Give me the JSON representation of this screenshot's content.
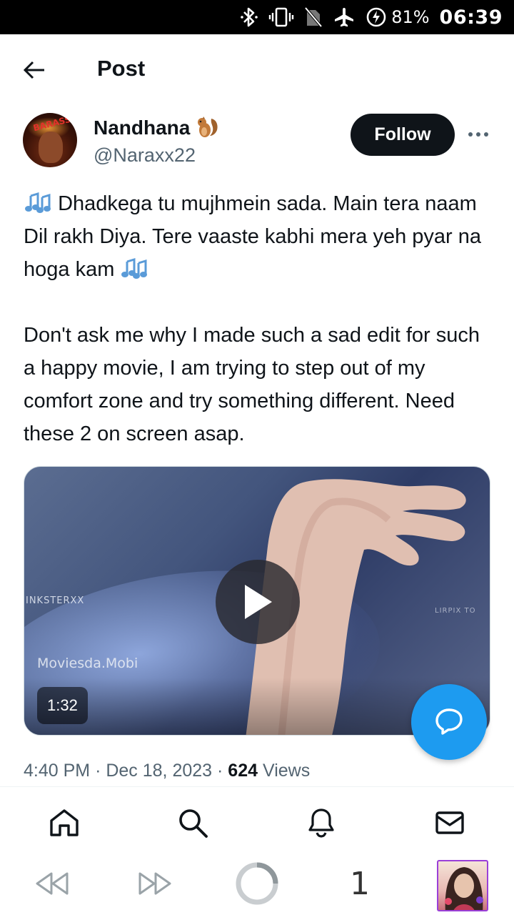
{
  "status_bar": {
    "battery_percent": "81%",
    "time": "06:39"
  },
  "header": {
    "title": "Post"
  },
  "author": {
    "name": "Nandhana",
    "handle": "@Naraxx22",
    "avatar_text": "BARASS"
  },
  "follow_label": "Follow",
  "tweet": {
    "paragraph1": "Dhadkega tu mujhmein sada. Main tera naam Dil rakh Diya. Tere vaaste kabhi mera yeh pyar na hoga  kam",
    "paragraph2": "Don't ask me why I made such a sad edit for such a happy movie, I am trying to step out of my comfort zone and try something different. Need these 2 on screen asap."
  },
  "media": {
    "duration": "1:32",
    "watermark_left": "INKSTERXX",
    "watermark_site": "Moviesda.Mobi",
    "watermark_right": "LIRPIX TO"
  },
  "meta": {
    "time": "4:40 PM",
    "separator": "·",
    "date": "Dec 18, 2023",
    "views_count": "624",
    "views_label": "Views"
  },
  "browser": {
    "tab_count": "1"
  },
  "colors": {
    "accent": "#1d9bf0",
    "text_primary": "#0f1419",
    "text_secondary": "#536471",
    "follow_bg": "#0f1419",
    "thumb_border": "#9a3fd8"
  }
}
